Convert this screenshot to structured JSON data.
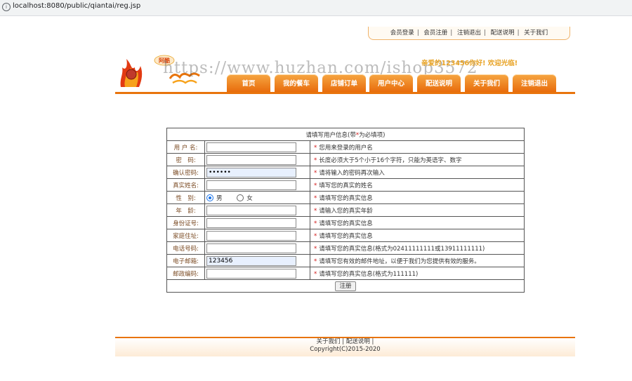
{
  "browser": {
    "url": "localhost:8080/public/qiantai/reg.jsp",
    "info_icon": "info-icon"
  },
  "top_links": [
    "会员登录",
    "会员注册",
    "注销退出",
    "配送说明",
    "关于我们"
  ],
  "welcome": "亲爱的123456你好! 欢迎光临!",
  "watermark": "https://www.huzhan.com/ishop3572",
  "logo": {
    "small_text": "阿酷"
  },
  "nav": [
    "首页",
    "我的餐车",
    "店铺订单",
    "用户中心",
    "配送说明",
    "关于我们",
    "注销退出"
  ],
  "colors": {
    "accent": "#e8740c",
    "tab_top": "#f6a642",
    "required": "#d01818",
    "label": "#7a4a22"
  },
  "form": {
    "title_pre": "请填写用户信息(带",
    "title_star": "*",
    "title_post": "为必填项)",
    "rows": [
      {
        "label": "用 户 名:",
        "value": "",
        "hint": "您用来登录的用户名"
      },
      {
        "label": "密　码:",
        "value": "",
        "hint": "长度必须大于5个小于16个字符，只能为英语字、数字"
      },
      {
        "label": "确认密码:",
        "value": "••••••",
        "hint": "请将输入的密码再次输入"
      },
      {
        "label": "真实姓名:",
        "value": "",
        "hint": "填写您的真实的姓名"
      },
      {
        "label": "性　别:",
        "hint": "请填写您的真实信息",
        "options": [
          "男",
          "女"
        ],
        "selected": "男"
      },
      {
        "label": "年　龄:",
        "value": "",
        "hint": "请输入您的真实年龄"
      },
      {
        "label": "身份证号:",
        "value": "",
        "hint": "请填写您的真实信息"
      },
      {
        "label": "家庭住址:",
        "value": "",
        "hint": "请填写您的真实信息"
      },
      {
        "label": "电话号码:",
        "value": "",
        "hint": "请填写您的真实信息(格式为02411111111或13911111111)"
      },
      {
        "label": "电子邮箱:",
        "value": "123456",
        "hint": "请填写您有效的邮件地址，以便于我们为您提供有效的服务。"
      },
      {
        "label": "邮政编码:",
        "value": "",
        "hint": "请填写您的真实信息(格式为111111)"
      }
    ],
    "submit": "注册"
  },
  "footer": {
    "links": [
      "关于我们",
      "配送说明"
    ],
    "copyright": "Copyright(C)2015-2020"
  }
}
